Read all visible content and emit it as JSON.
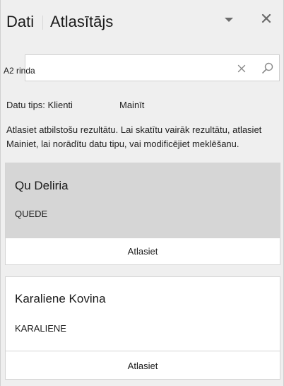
{
  "header": {
    "tab_data": "Dati",
    "tab_selector": "Atlasītājs",
    "options_icon": "chevron-down-icon",
    "close_icon": "close-icon"
  },
  "search": {
    "value": "A2 rinda",
    "clear_icon": "clear-icon",
    "search_icon": "search-icon"
  },
  "data_type": {
    "label": "Datu tips: Klienti",
    "change_label": "Mainīt"
  },
  "instructions": "Atlasiet atbilstošu rezultātu. Lai skatītu vairāk rezultātu, atlasiet Mainiet, lai norādītu datu tipu, vai modificējiet meklēšanu.",
  "results": [
    {
      "name": "Qu Deliria",
      "code": "QUEDE",
      "select_label": "Atlasiet"
    },
    {
      "name": "Karaliene Kovina",
      "code": "KARALIENE",
      "select_label": "Atlasiet"
    }
  ],
  "colors": {
    "panel_bg": "#efefef",
    "selected_card_bg": "#d6d6d6",
    "card_bg": "#ffffff",
    "text": "#1f1f1f"
  }
}
